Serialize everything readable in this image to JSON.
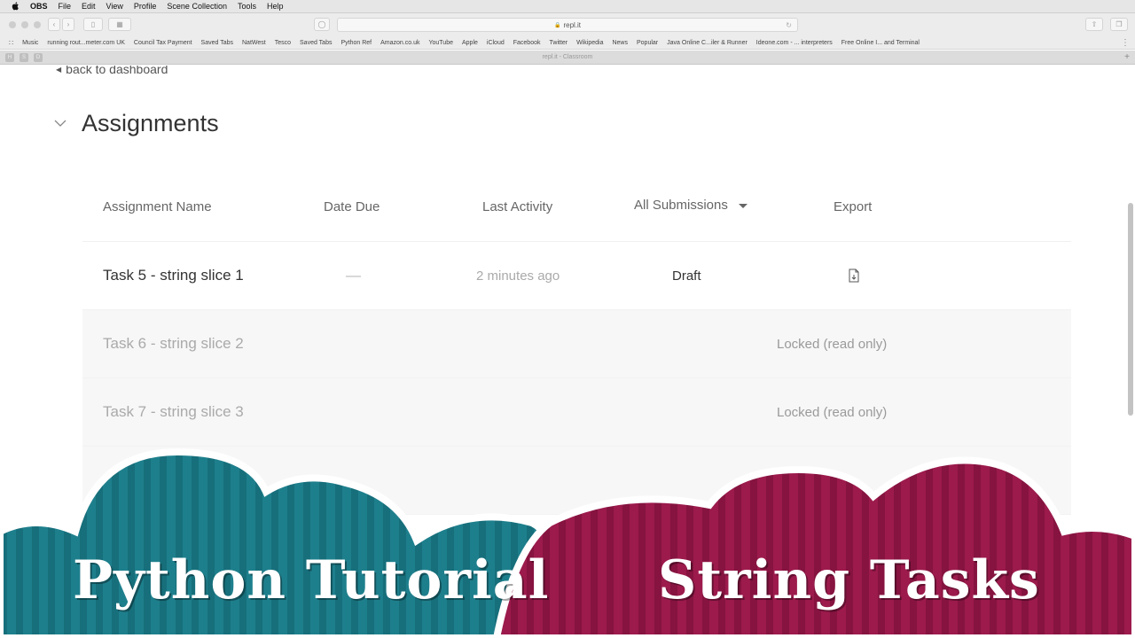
{
  "menubar": {
    "app": "OBS",
    "items": [
      "File",
      "Edit",
      "View",
      "Profile",
      "Scene Collection",
      "Tools",
      "Help"
    ]
  },
  "browser": {
    "url": "repl.it",
    "tab_title": "repl.it - Classroom",
    "favorites": [
      "Music",
      "running rout...meter.com UK",
      "Council Tax Payment",
      "Saved Tabs",
      "NatWest",
      "Tesco",
      "Saved Tabs",
      "Python Ref",
      "Amazon.co.uk",
      "YouTube",
      "Apple",
      "iCloud",
      "Facebook",
      "Twitter",
      "Wikipedia",
      "News",
      "Popular",
      "Java Online C...iler & Runner",
      "Ideone.com - ... interpreters",
      "Free Online I... and Terminal"
    ],
    "pinned": [
      "H",
      "S",
      "D"
    ]
  },
  "page": {
    "back_link": "back to dashboard",
    "section_title": "Assignments",
    "columns": {
      "name": "Assignment Name",
      "date": "Date Due",
      "activity": "Last Activity",
      "submissions": "All Submissions",
      "export": "Export"
    },
    "rows": [
      {
        "name": "Task 5 - string slice 1",
        "date": "—",
        "activity": "2 minutes ago",
        "status": "Draft"
      },
      {
        "name": "Task 6 - string slice 2",
        "lock": "Locked (read only)"
      },
      {
        "name": "Task 7 - string slice 3",
        "lock": "Locked (read only)"
      }
    ]
  },
  "banner": {
    "left_text": "Python Tutorial",
    "right_text": "String Tasks",
    "left_color": "#1e7f8c",
    "right_color": "#9c1a4c"
  }
}
